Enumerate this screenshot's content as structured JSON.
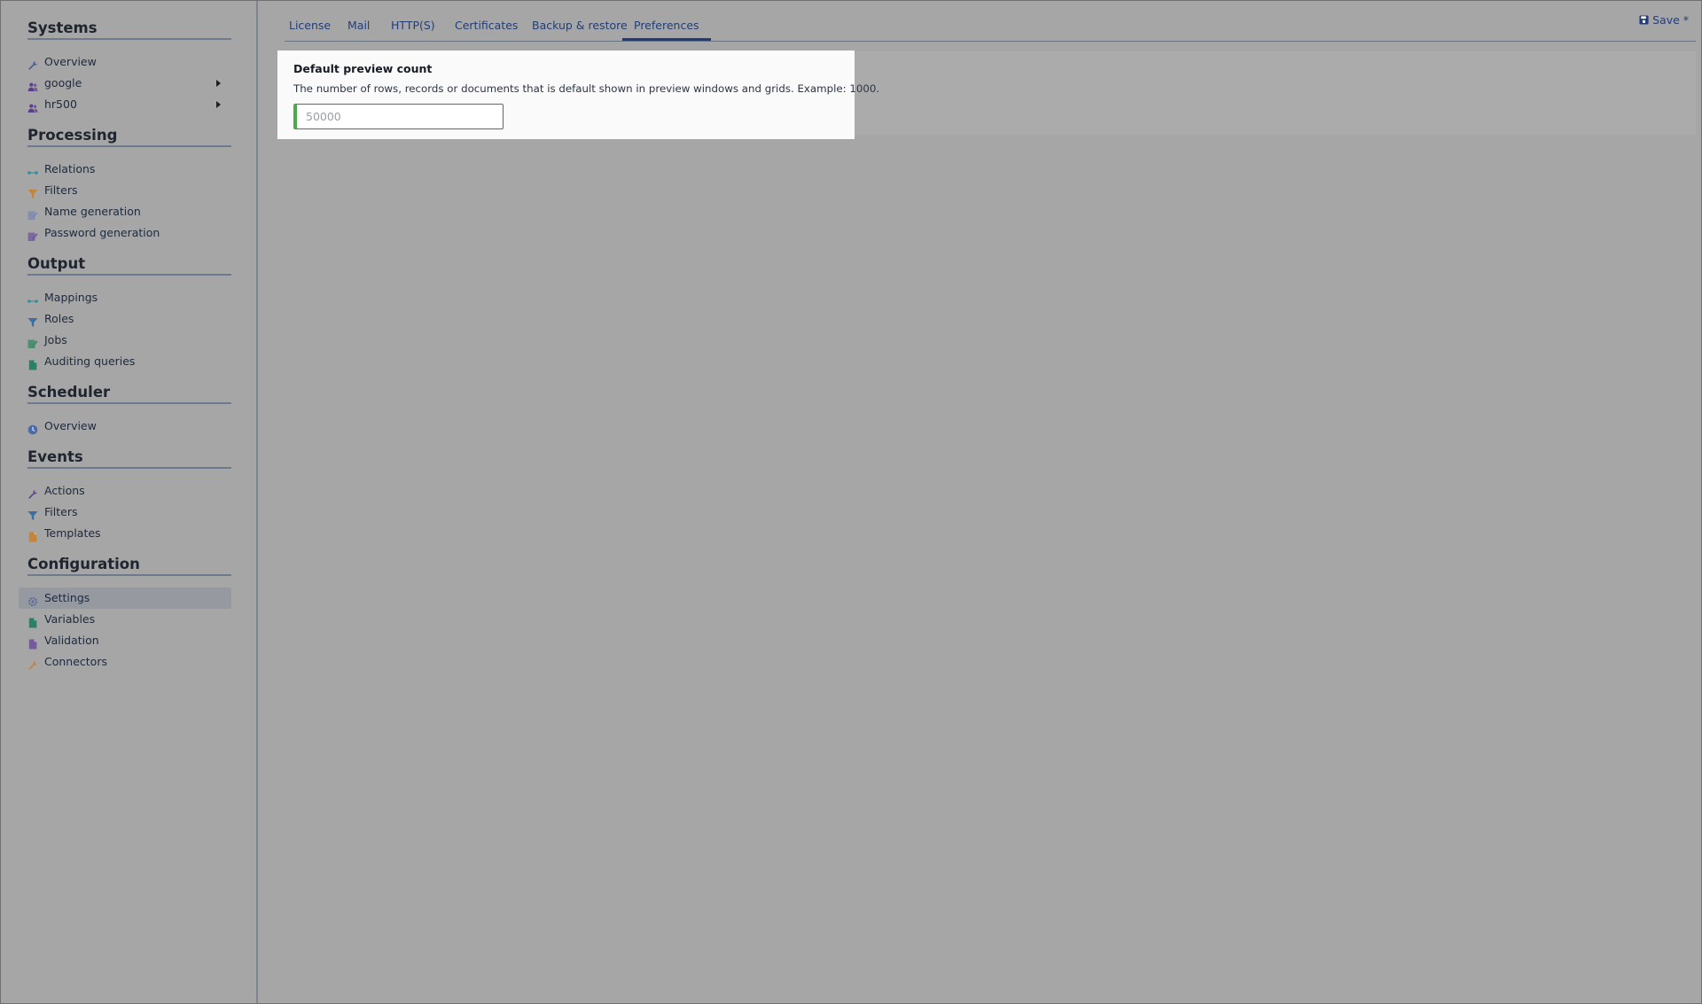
{
  "sidebar": {
    "sections": [
      {
        "title": "Systems",
        "items": [
          {
            "label": "Overview",
            "icon": "wrench-icon",
            "color": "#3a5b9a"
          },
          {
            "label": "google",
            "icon": "users-icon",
            "color": "#5b3f8d",
            "expandable": true
          },
          {
            "label": "hr500",
            "icon": "users-icon",
            "color": "#5b3f8d",
            "expandable": true
          }
        ]
      },
      {
        "title": "Processing",
        "items": [
          {
            "label": "Relations",
            "icon": "relations-icon",
            "color": "#2f8f99"
          },
          {
            "label": "Filters",
            "icon": "filter-icon",
            "color": "#c4843a"
          },
          {
            "label": "Name generation",
            "icon": "edit-icon",
            "color": "#7d8bb4"
          },
          {
            "label": "Password generation",
            "icon": "edit-icon",
            "color": "#735a9c"
          }
        ]
      },
      {
        "title": "Output",
        "items": [
          {
            "label": "Mappings",
            "icon": "relations-icon",
            "color": "#2f8f99"
          },
          {
            "label": "Roles",
            "icon": "filter-icon",
            "color": "#3a6ea0"
          },
          {
            "label": "Jobs",
            "icon": "edit-icon",
            "color": "#3a8a63"
          },
          {
            "label": "Auditing queries",
            "icon": "document-icon",
            "color": "#2d8068"
          }
        ]
      },
      {
        "title": "Scheduler",
        "items": [
          {
            "label": "Overview",
            "icon": "clock-icon",
            "color": "#4a6aa8"
          }
        ]
      },
      {
        "title": "Events",
        "items": [
          {
            "label": "Actions",
            "icon": "wrench-icon",
            "color": "#5b3f8d"
          },
          {
            "label": "Filters",
            "icon": "filter-icon",
            "color": "#3a6ea0"
          },
          {
            "label": "Templates",
            "icon": "document-icon",
            "color": "#c4843a"
          }
        ]
      },
      {
        "title": "Configuration",
        "items": [
          {
            "label": "Settings",
            "icon": "gear-icon",
            "color": "#5b6e96",
            "active": true
          },
          {
            "label": "Variables",
            "icon": "document-icon",
            "color": "#2d8068"
          },
          {
            "label": "Validation",
            "icon": "document-icon",
            "color": "#735a9c"
          },
          {
            "label": "Connectors",
            "icon": "wrench-icon",
            "color": "#c4843a"
          }
        ]
      }
    ]
  },
  "tabs": [
    {
      "label": "License",
      "active": false
    },
    {
      "label": "Mail",
      "active": false
    },
    {
      "label": "HTTP(S)",
      "active": false
    },
    {
      "label": "Certificates",
      "active": false
    },
    {
      "label": "Backup & restore",
      "active": false
    },
    {
      "label": "Preferences",
      "active": true
    }
  ],
  "toolbar": {
    "save_label": "Save *",
    "save_icon": "floppy-disk-icon"
  },
  "preferences": {
    "field_label": "Default preview count",
    "field_description": "The number of rows, records or documents that is default shown in preview windows and grids. Example: 1000.",
    "field_value": "50000"
  },
  "colors": {
    "accent": "#223d78",
    "input_border": "#3a6eb0",
    "input_valid": "#4fa84a",
    "overlay": "#a6a6a6"
  }
}
